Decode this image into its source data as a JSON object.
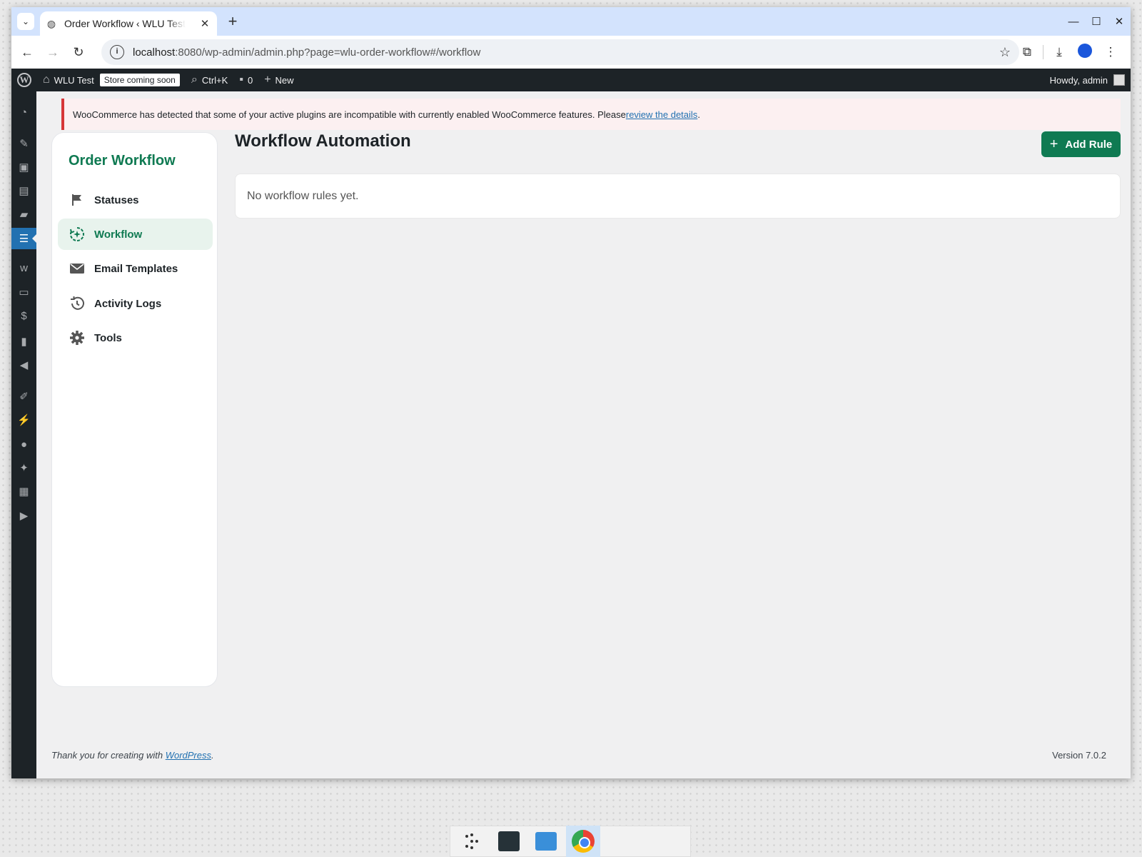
{
  "browser": {
    "tab_title": "Order Workflow ‹ WLU Test",
    "url_host": "localhost",
    "url_rest": ":8080/wp-admin/admin.php?page=wlu-order-workflow#/workflow"
  },
  "adminbar": {
    "site_name": "WLU Test",
    "store_badge": "Store coming soon",
    "search_shortcut": "Ctrl+K",
    "comments_count": "0",
    "new_label": "New",
    "howdy": "Howdy, admin"
  },
  "notice": {
    "text": "WooCommerce has detected that some of your active plugins are incompatible with currently enabled WooCommerce features. Please ",
    "link": "review the details",
    "end": "."
  },
  "app": {
    "title": "Order Workflow",
    "nav": [
      {
        "label": "Statuses",
        "icon": "flag-icon"
      },
      {
        "label": "Workflow",
        "icon": "workflow-icon",
        "active": true
      },
      {
        "label": "Email Templates",
        "icon": "envelope-icon"
      },
      {
        "label": "Activity Logs",
        "icon": "history-icon"
      },
      {
        "label": "Tools",
        "icon": "gear-icon"
      }
    ]
  },
  "main": {
    "title": "Workflow Automation",
    "add_rule_label": "Add Rule",
    "empty_text": "No workflow rules yet."
  },
  "footer": {
    "thanks_prefix": "Thank you for creating with ",
    "wp_link": "WordPress",
    "thanks_suffix": ".",
    "version": "Version 7.0.2"
  },
  "colors": {
    "accent": "#0f7a52",
    "adminbar": "#1d2327",
    "notice_border": "#d63638"
  }
}
